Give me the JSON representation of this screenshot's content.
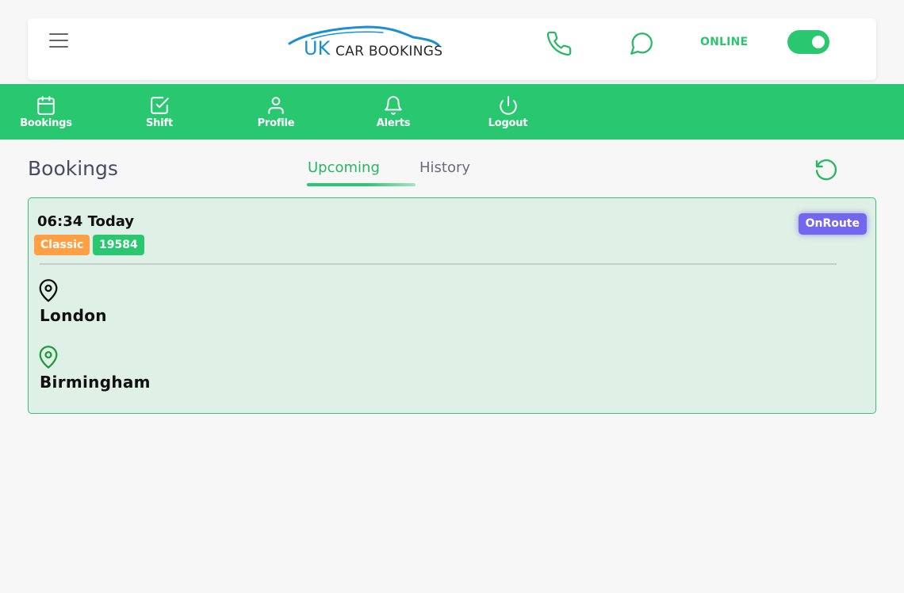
{
  "header": {
    "logo_uk": "UK",
    "logo_rest": "CAR BOOKINGS",
    "status_label": "ONLINE",
    "toggle_on": true
  },
  "nav": {
    "items": [
      {
        "label": "Bookings",
        "icon": "calendar-icon"
      },
      {
        "label": "Shift",
        "icon": "checkbox-icon"
      },
      {
        "label": "Profile",
        "icon": "user-icon"
      },
      {
        "label": "Alerts",
        "icon": "bell-icon"
      },
      {
        "label": "Logout",
        "icon": "power-icon"
      }
    ]
  },
  "main": {
    "title": "Bookings",
    "tabs": [
      {
        "label": "Upcoming",
        "active": true
      },
      {
        "label": "History",
        "active": false
      }
    ]
  },
  "booking": {
    "time": "06:34 Today",
    "vehicle_class": "Classic",
    "booking_id": "19584",
    "status": "OnRoute",
    "pickup": "London",
    "dropoff": "Birmingham"
  },
  "colors": {
    "brand_green": "#29c76f",
    "status_purple": "#7367f0",
    "class_orange": "#ff9f43",
    "logo_blue": "#1a8fd6"
  }
}
